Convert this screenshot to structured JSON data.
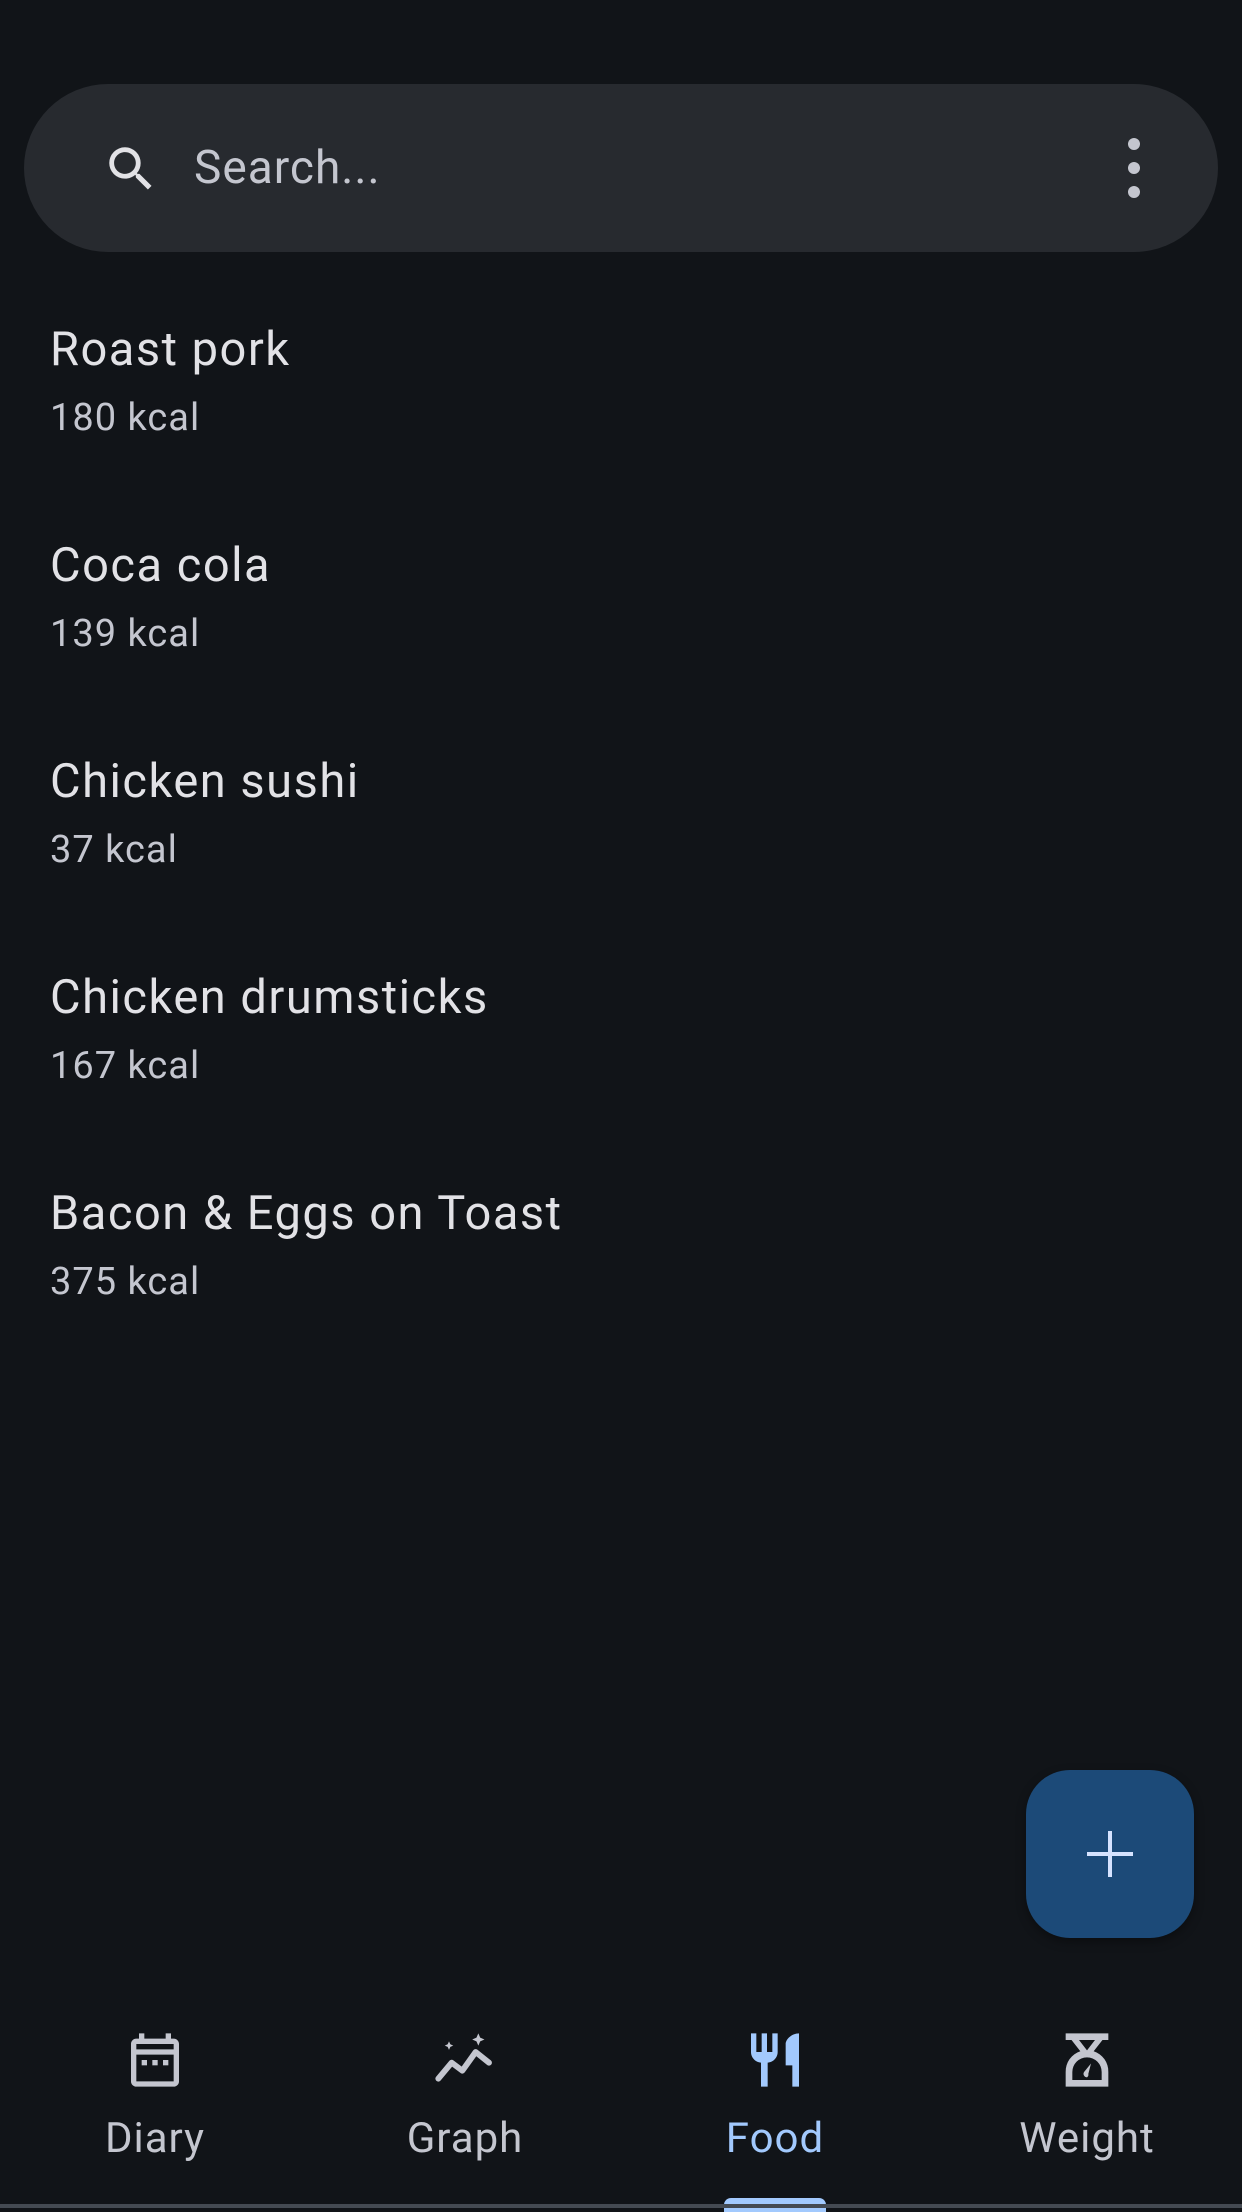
{
  "status_bar": {
    "partial_text": ""
  },
  "search": {
    "placeholder": "Search...",
    "value": "",
    "icon": "search-icon",
    "menu_icon": "more-vert-icon"
  },
  "foods": [
    {
      "name": "Roast pork",
      "kcal": "180 kcal"
    },
    {
      "name": "Coca cola",
      "kcal": "139 kcal"
    },
    {
      "name": "Chicken sushi",
      "kcal": "37 kcal"
    },
    {
      "name": "Chicken drumsticks",
      "kcal": "167 kcal"
    },
    {
      "name": "Bacon & Eggs on Toast",
      "kcal": "375 kcal"
    }
  ],
  "fab": {
    "icon": "plus-icon"
  },
  "bottom_nav": {
    "active": "Food",
    "items": [
      {
        "label": "Diary",
        "icon": "calendar-icon"
      },
      {
        "label": "Graph",
        "icon": "graph-icon"
      },
      {
        "label": "Food",
        "icon": "restaurant-icon"
      },
      {
        "label": "Weight",
        "icon": "scale-icon"
      }
    ]
  },
  "colors": {
    "background": "#111418",
    "surface": "#272a2f",
    "on_surface": "#e2e2e6",
    "on_surface_variant": "#c4c6cf",
    "primary": "#a2c9fd",
    "fab": "#1c4a78"
  }
}
